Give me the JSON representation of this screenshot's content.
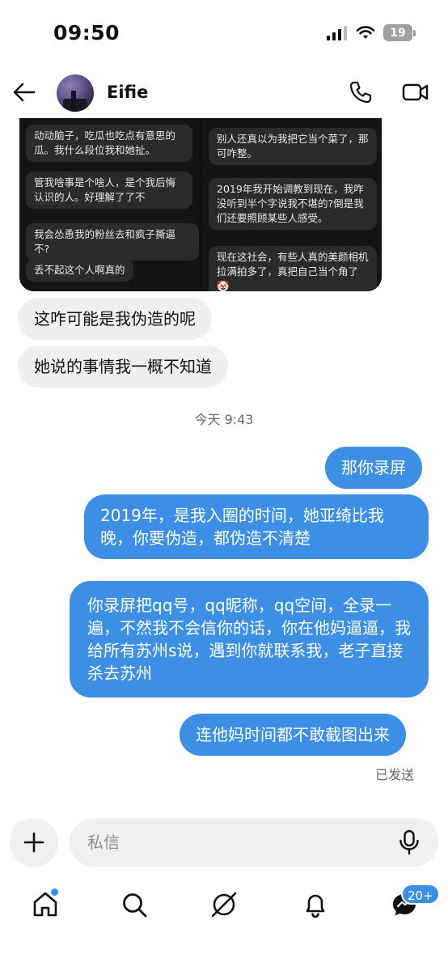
{
  "status_bar": {
    "time": "09:50",
    "battery": "19"
  },
  "header": {
    "contact_name": "Eifie"
  },
  "shared_image": {
    "left_bubbles": [
      "动动脑子，吃瓜也吃点有意思的瓜。我什么段位我和她扯。",
      "管我啥事是个啥人，是个我后悔认识的人。好理解了了不",
      "我会怂恿我的粉丝去和疯子撕逼不?",
      "丢不起这个人啊真的"
    ],
    "right_bubbles": [
      "别人还真以为我把它当个菜了，那可咋整。",
      "2019年我开始调教到现在，我咋没听到半个字说我不堪的?倒是我们还要照顾某些人感受。",
      "现在这社会，有些人真的美颜相机拉满拍多了，真把自己当个角了🤡"
    ]
  },
  "messages": [
    {
      "dir": "in",
      "text": "这咋可能是我伪造的呢"
    },
    {
      "dir": "in",
      "text": "她说的事情我一概不知道"
    },
    {
      "dir": "out",
      "text": "那你录屏"
    },
    {
      "dir": "out",
      "text": "2019年，是我入圈的时间，她亚绮比我晚，你要伪造，都伪造不清楚"
    },
    {
      "dir": "out",
      "text": "你录屏把qq号，qq昵称，qq空间，全录一遍，不然我不会信你的话，你在他妈逼逼，我给所有苏州s说，遇到你就联系我，老子直接杀去苏州"
    },
    {
      "dir": "out",
      "text": "连他妈时间都不敢截图出来"
    }
  ],
  "timestamp": "今天 9:43",
  "sent_status": "已发送",
  "composer": {
    "placeholder": "私信"
  },
  "tab_bar": {
    "messages_badge": "20+"
  },
  "icons": {
    "back": "arrow-left-icon",
    "call": "phone-icon",
    "video": "video-camera-icon",
    "plus": "plus-icon",
    "mic": "microphone-icon",
    "home": "home-icon",
    "search": "search-icon",
    "explore": "compass-icon",
    "notifications": "bell-icon",
    "messages": "chat-bubble-icon"
  },
  "colors": {
    "outgoing_bubble": "#3d8fe6",
    "incoming_bubble": "#efefef",
    "accent": "#3d8fe6"
  }
}
